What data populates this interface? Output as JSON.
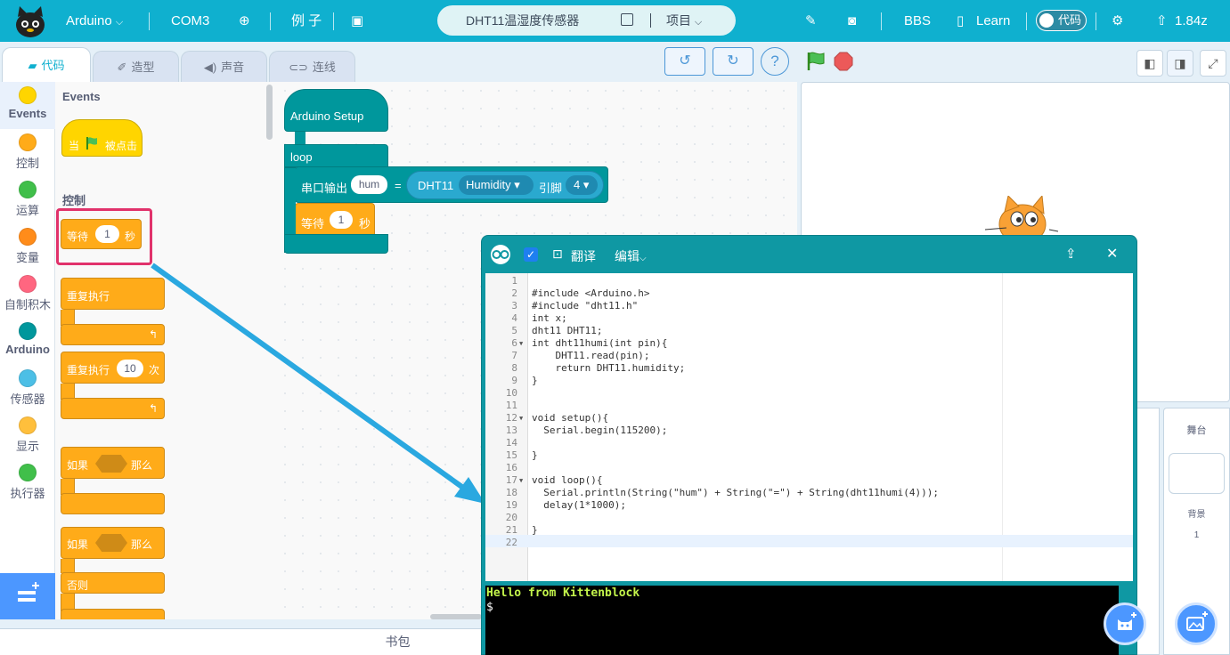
{
  "menubar": {
    "board": "Arduino",
    "port": "COM3",
    "examples": "例 子",
    "project_title": "DHT11温湿度传感器",
    "project_menu": "项目",
    "bbs": "BBS",
    "learn": "Learn",
    "code_toggle": "代码",
    "version": "1.84z"
  },
  "tabs": [
    {
      "label": "代码",
      "icon": "code-icon"
    },
    {
      "label": "造型",
      "icon": "brush-icon"
    },
    {
      "label": "声音",
      "icon": "sound-icon"
    },
    {
      "label": "连线",
      "icon": "wire-icon"
    }
  ],
  "categories": [
    {
      "label": "Events",
      "color": "#ffd500"
    },
    {
      "label": "控制",
      "color": "#ffab19"
    },
    {
      "label": "运算",
      "color": "#40bf4a"
    },
    {
      "label": "变量",
      "color": "#ff8c1a"
    },
    {
      "label": "自制积木",
      "color": "#ff6680"
    },
    {
      "label": "Arduino",
      "color": "#00979c"
    },
    {
      "label": "传感器",
      "color": "#4cbfe6"
    },
    {
      "label": "显示",
      "color": "#ffbf3c"
    },
    {
      "label": "执行器",
      "color": "#40bf4a"
    }
  ],
  "palette": {
    "events_header": "Events",
    "when_flag": "当",
    "when_flag_suffix": "被点击",
    "control_header": "控制",
    "wait": "等待",
    "wait_value": "1",
    "wait_unit": "秒",
    "forever": "重复执行",
    "repeat": "重复执行",
    "repeat_value": "10",
    "repeat_unit": "次",
    "if_label": "如果",
    "then_label": "那么",
    "if2_label": "如果",
    "then2_label": "那么",
    "else_label": "否则"
  },
  "workspace": {
    "setup": "Arduino Setup",
    "loop": "loop",
    "serial_print": "串口输出",
    "var_name": "hum",
    "equals": "=",
    "sensor": "DHT11",
    "sensor_mode": "Humidity",
    "pin_label": "引脚",
    "pin_value": "4",
    "wait": "等待",
    "wait_value": "1",
    "wait_unit": "秒"
  },
  "codepanel": {
    "compile_label": "翻译",
    "edit_label": "编辑",
    "code_lines": [
      "",
      "#include <Arduino.h>",
      "#include \"dht11.h\"",
      "int x;",
      "dht11 DHT11;",
      "int dht11humi(int pin){",
      "    DHT11.read(pin);",
      "    return DHT11.humidity;",
      "}",
      "",
      "",
      "void setup(){",
      "  Serial.begin(115200);",
      "",
      "}",
      "",
      "void loop(){",
      "  Serial.println(String(\"hum\") + String(\"=\") + String(dht11humi(4)));",
      "  delay(1*1000);",
      "",
      "}",
      ""
    ],
    "line_numbers": [
      "1",
      "2",
      "3",
      "4",
      "5",
      "6",
      "7",
      "8",
      "9",
      "10",
      "11",
      "12",
      "13",
      "14",
      "15",
      "16",
      "17",
      "18",
      "19",
      "20",
      "21",
      "22"
    ],
    "terminal_line1": "Hello from Kittenblock",
    "terminal_prompt": "$"
  },
  "stage_pane": {
    "title": "舞台",
    "backdrop_label": "背景",
    "backdrop_count": "1"
  },
  "backpack_label": "书包"
}
